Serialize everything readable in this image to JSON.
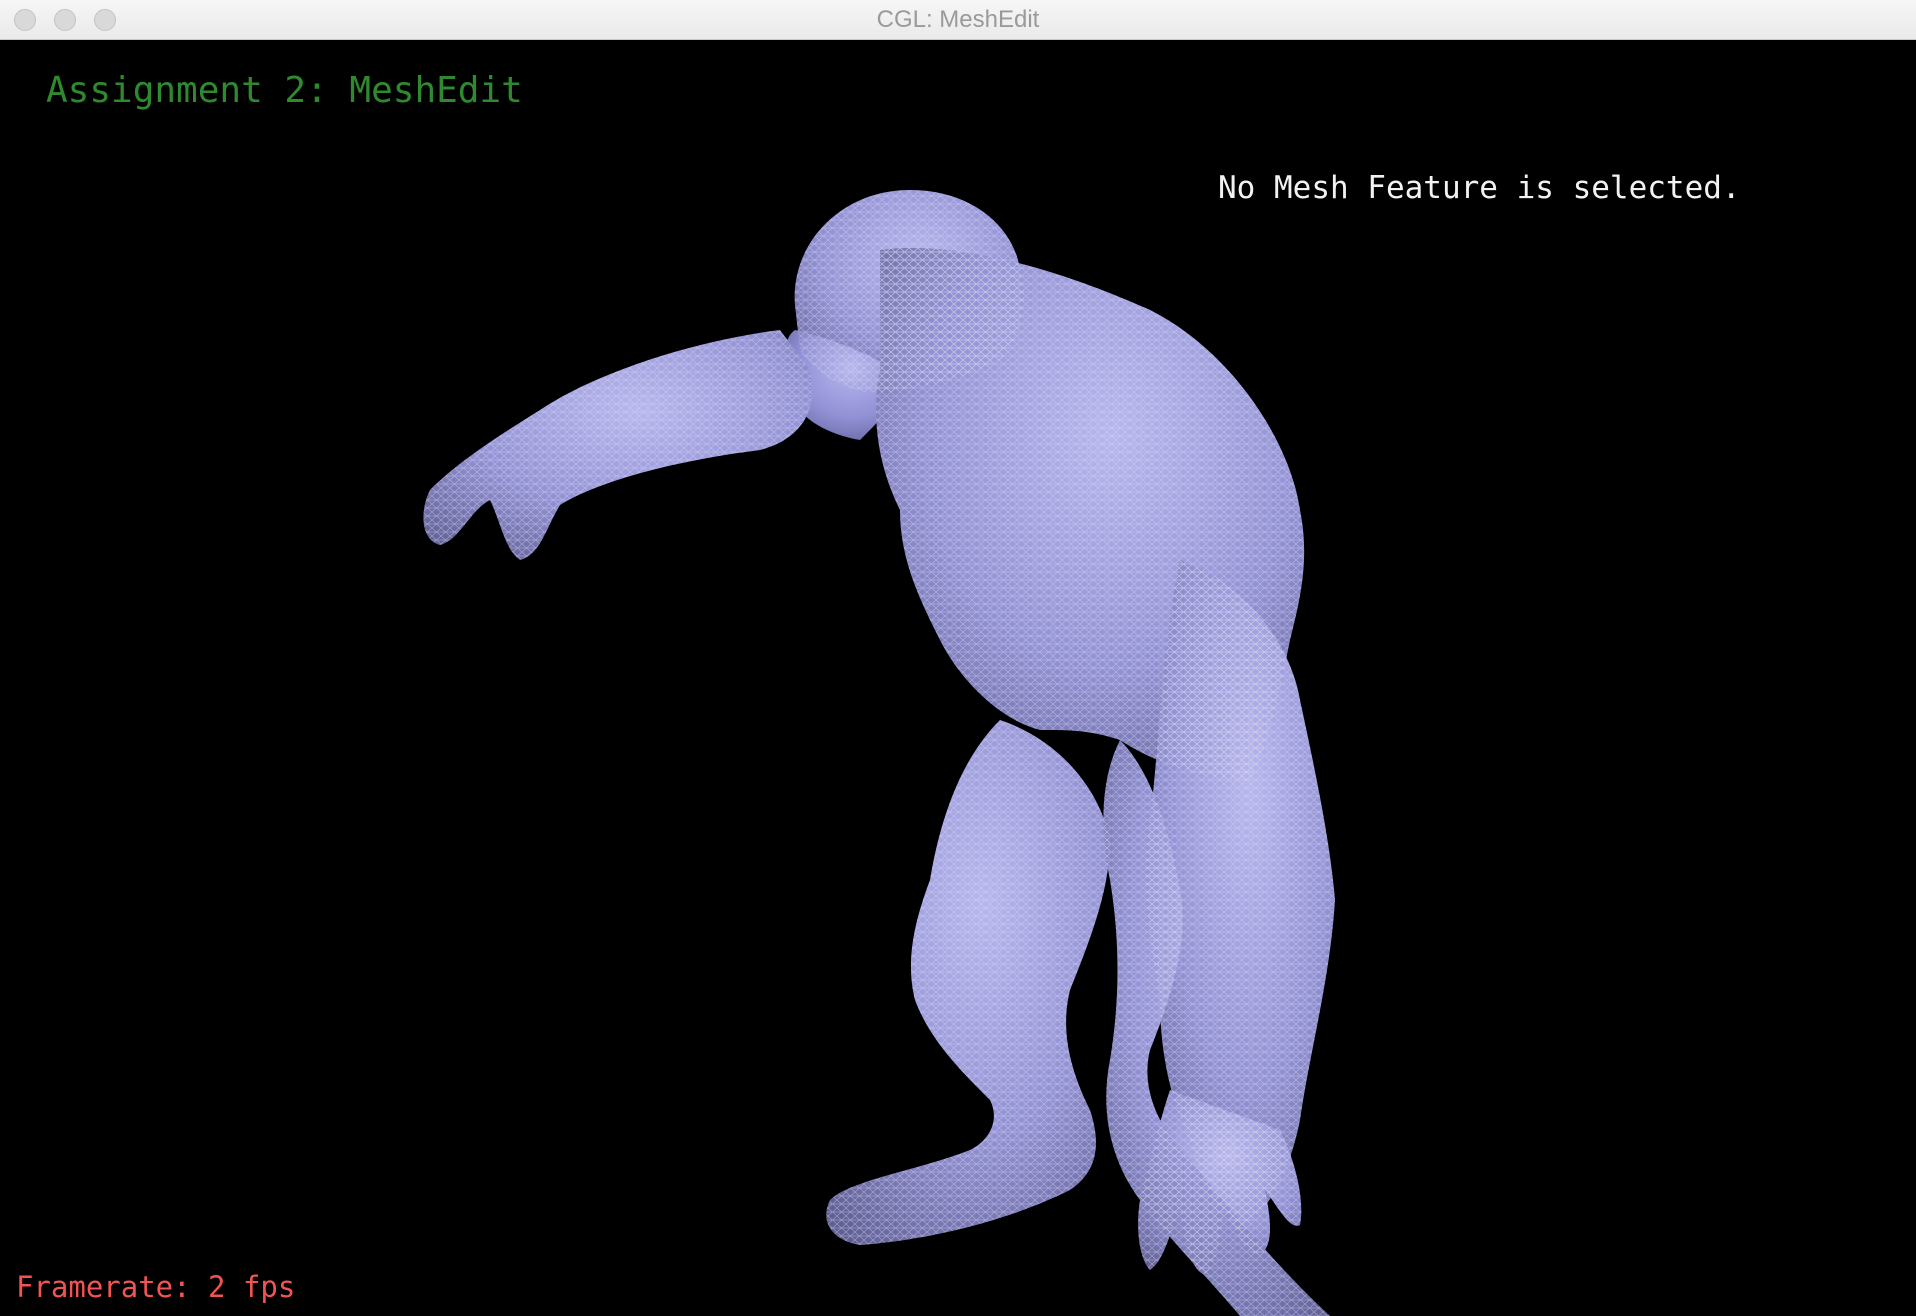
{
  "window": {
    "title": "CGL: MeshEdit"
  },
  "hud": {
    "assignment_title": "Assignment 2: MeshEdit",
    "selection_status": "No Mesh Feature is selected.",
    "framerate": "Framerate: 2 fps"
  },
  "colors": {
    "background": "#000000",
    "title_text": "#2f8a2f",
    "status_text": "#f2f2f2",
    "framerate_text": "#f25454",
    "mesh_fill": "#9c9ae0",
    "mesh_wire": "#d8d8e6"
  },
  "icons": {
    "window_controls": [
      "close-icon",
      "minimize-icon",
      "zoom-icon"
    ]
  }
}
